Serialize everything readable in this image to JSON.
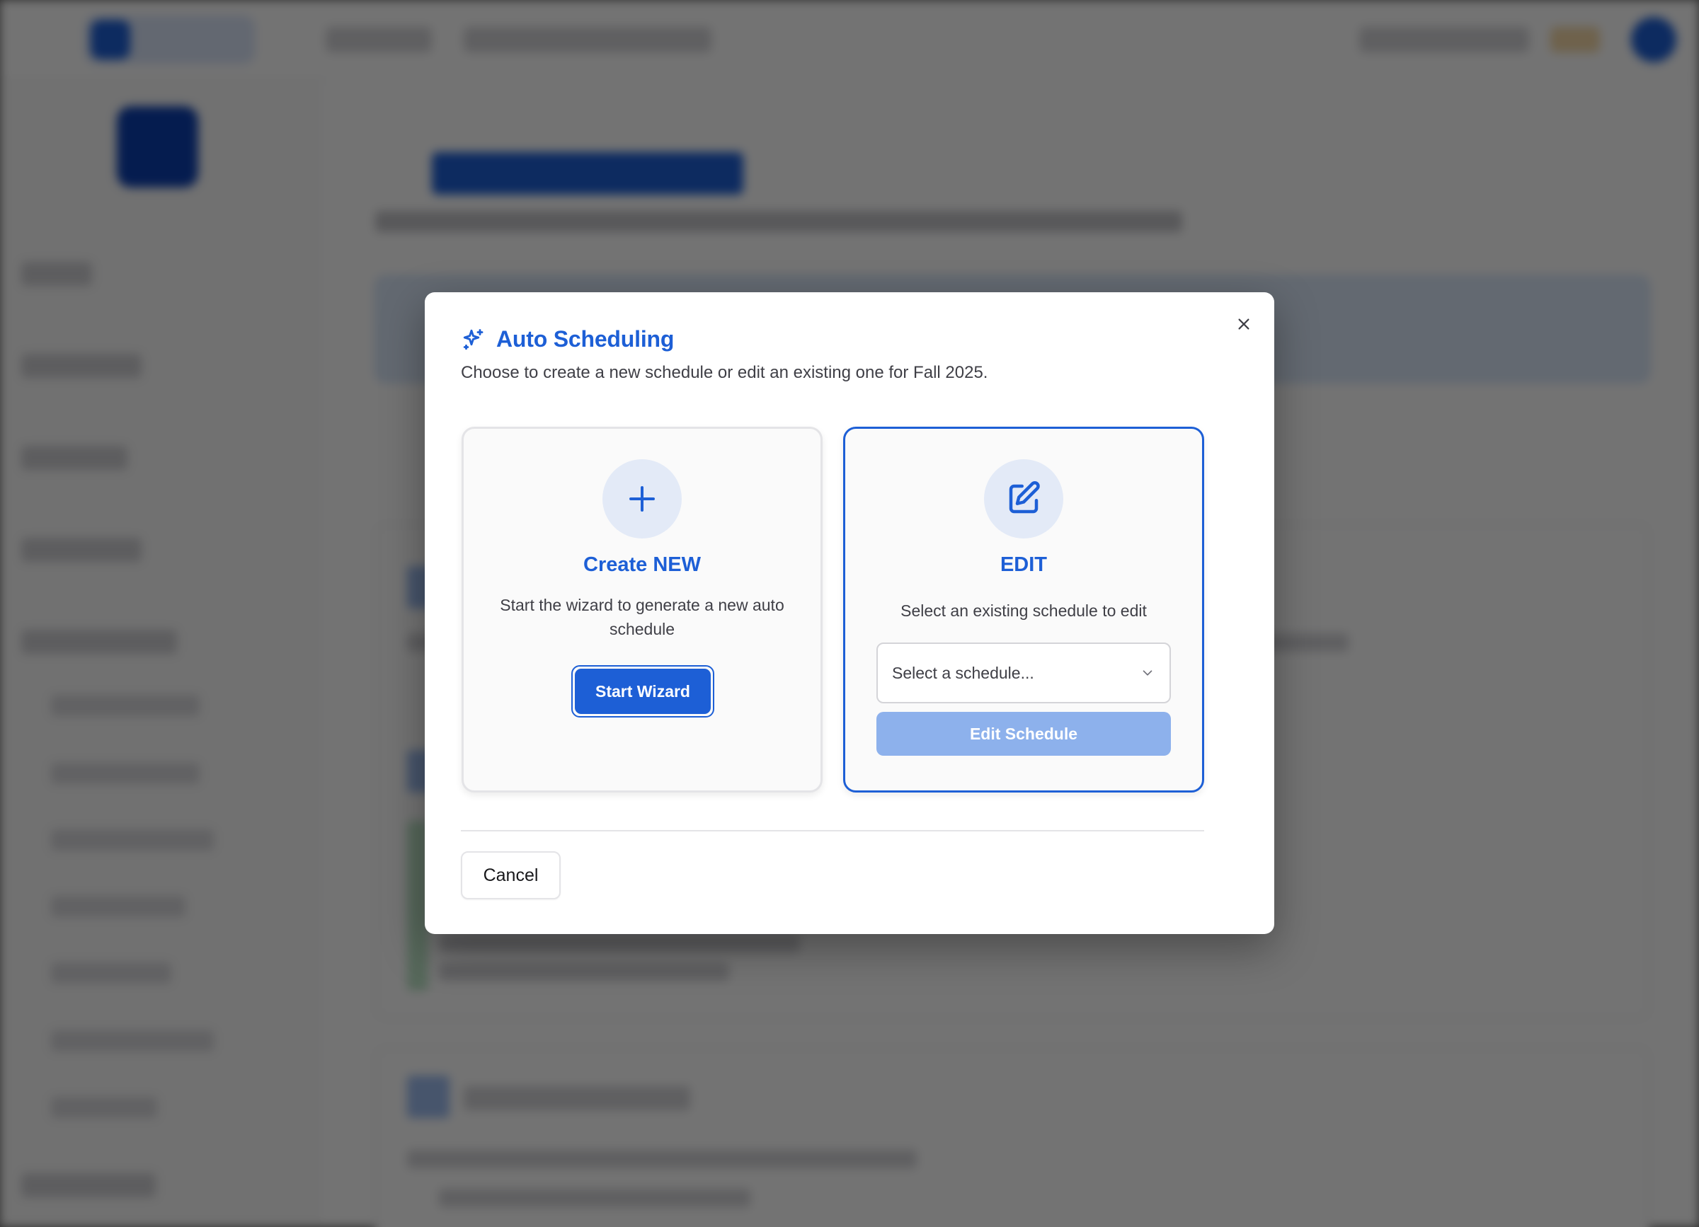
{
  "dialog": {
    "title": "Auto Scheduling",
    "description": "Choose to create a new schedule or edit an existing one for Fall 2025.",
    "close_icon": "close-icon",
    "title_icon": "sparkles-icon"
  },
  "create_option": {
    "icon": "plus-icon",
    "title": "Create NEW",
    "description": "Start the wizard to generate a new auto schedule",
    "button_label": "Start Wizard"
  },
  "edit_option": {
    "icon": "edit-icon",
    "title": "EDIT",
    "description": "Select an existing schedule to edit",
    "select_placeholder": "Select a schedule...",
    "button_label": "Edit Schedule",
    "button_disabled": true
  },
  "footer": {
    "cancel_label": "Cancel"
  },
  "colors": {
    "accent": "#1d5fd6",
    "accent_disabled": "#8db1ec",
    "icon_bg": "#e3eaf7",
    "overlay": "rgba(0,0,0,0.55)"
  }
}
